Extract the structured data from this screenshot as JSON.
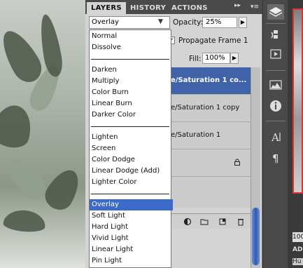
{
  "tabs": [
    {
      "label": "LAYERS",
      "active": true
    },
    {
      "label": "HISTORY",
      "active": false
    },
    {
      "label": "ACTIONS",
      "active": false
    }
  ],
  "tab_more_glyph": "▸▸",
  "tab_menu_glyph": "▾≡",
  "blend": {
    "selected": "Overlay",
    "options_groups": [
      [
        "Normal",
        "Dissolve"
      ],
      [
        "Darken",
        "Multiply",
        "Color Burn",
        "Linear Burn",
        "Darker Color"
      ],
      [
        "Lighten",
        "Screen",
        "Color Dodge",
        "Linear Dodge (Add)",
        "Lighter Color"
      ],
      [
        "Overlay",
        "Soft Light",
        "Hard Light",
        "Vivid Light",
        "Linear Light",
        "Pin Light"
      ]
    ]
  },
  "opacity": {
    "label": "Opacity:",
    "value": "25%"
  },
  "propagate": {
    "label": "Propagate Frame 1",
    "checked": true
  },
  "fill": {
    "label": "Fill:",
    "value": "100%"
  },
  "layers": [
    {
      "name": "e/Saturation 1 co...",
      "selected": true
    },
    {
      "name": "e/Saturation 1 copy",
      "selected": false
    },
    {
      "name": "e/Saturation 1",
      "selected": false
    },
    {
      "name": "",
      "selected": false,
      "locked": true
    }
  ],
  "preview": {
    "number": "100",
    "tab": "AD",
    "hu": "Hu"
  },
  "colors": {
    "selection": "#3d6ac9",
    "layer_selected": "#3f62a8",
    "tab_bar": "#4a4a4a"
  }
}
